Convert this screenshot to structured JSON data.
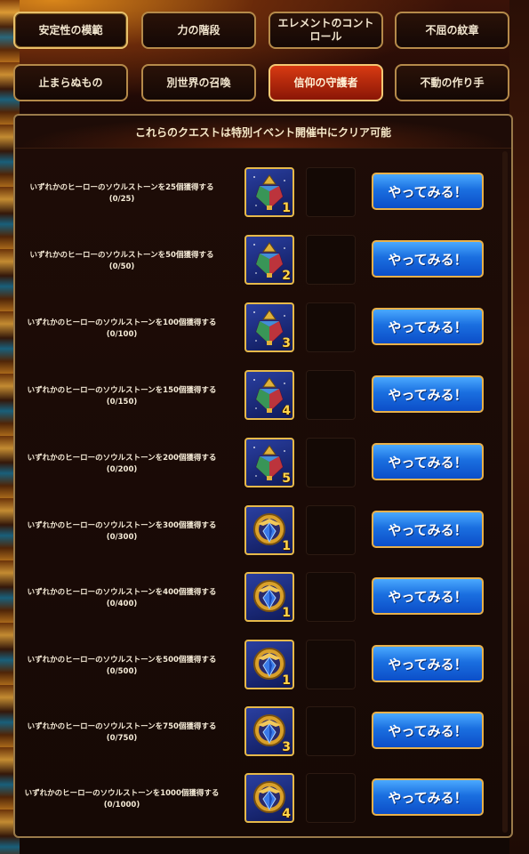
{
  "tabs": [
    {
      "label": "安定性の模範"
    },
    {
      "label": "力の階段"
    },
    {
      "label": "エレメントのコントロール"
    },
    {
      "label": "不屈の紋章"
    },
    {
      "label": "止まらぬもの"
    },
    {
      "label": "別世界の召喚"
    },
    {
      "label": "信仰の守護者"
    },
    {
      "label": "不動の作り手"
    }
  ],
  "active_tab": "信仰の守護者",
  "panel": {
    "header": "これらのクエストは特別イベント開催中にクリア可能"
  },
  "quests": [
    {
      "text": "いずれかのヒーローのソウルストーンを25個獲得する",
      "progress": "(0/25)",
      "reward_icon": "lantern-icon",
      "reward_count": "1",
      "button": "やってみる！"
    },
    {
      "text": "いずれかのヒーローのソウルストーンを50個獲得する",
      "progress": "(0/50)",
      "reward_icon": "lantern-icon",
      "reward_count": "2",
      "button": "やってみる！"
    },
    {
      "text": "いずれかのヒーローのソウルストーンを100個獲得する",
      "progress": "(0/100)",
      "reward_icon": "lantern-icon",
      "reward_count": "3",
      "button": "やってみる！"
    },
    {
      "text": "いずれかのヒーローのソウルストーンを150個獲得する",
      "progress": "(0/150)",
      "reward_icon": "lantern-icon",
      "reward_count": "4",
      "button": "やってみる！"
    },
    {
      "text": "いずれかのヒーローのソウルストーンを200個獲得する",
      "progress": "(0/200)",
      "reward_icon": "lantern-icon",
      "reward_count": "5",
      "button": "やってみる！"
    },
    {
      "text": "いずれかのヒーローのソウルストーンを300個獲得する",
      "progress": "(0/300)",
      "reward_icon": "emblem-icon",
      "reward_count": "1",
      "button": "やってみる！"
    },
    {
      "text": "いずれかのヒーローのソウルストーンを400個獲得する",
      "progress": "(0/400)",
      "reward_icon": "emblem-icon",
      "reward_count": "1",
      "button": "やってみる！"
    },
    {
      "text": "いずれかのヒーローのソウルストーンを500個獲得する",
      "progress": "(0/500)",
      "reward_icon": "emblem-icon",
      "reward_count": "1",
      "button": "やってみる！"
    },
    {
      "text": "いずれかのヒーローのソウルストーンを750個獲得する",
      "progress": "(0/750)",
      "reward_icon": "emblem-icon",
      "reward_count": "3",
      "button": "やってみる！"
    },
    {
      "text": "いずれかのヒーローのソウルストーンを1000個獲得する",
      "progress": "(0/1000)",
      "reward_icon": "emblem-icon",
      "reward_count": "4",
      "button": "やってみる！"
    }
  ]
}
